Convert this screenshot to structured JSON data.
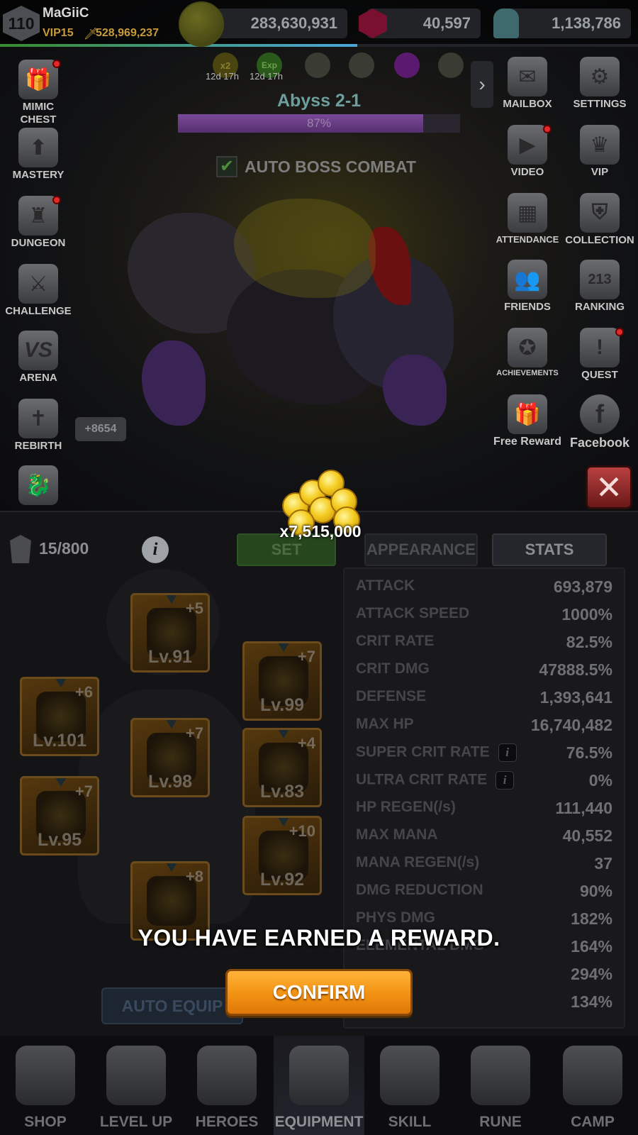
{
  "player": {
    "level": "110",
    "name": "MaGiiC",
    "vip": "VIP15",
    "power": "528,969,237"
  },
  "currencies": {
    "gold": "283,630,931",
    "ruby": "40,597",
    "stone": "1,138,786"
  },
  "buffs": [
    {
      "icon": "x2-gold-buff-icon",
      "label": "x2",
      "timer": "12d 17h"
    },
    {
      "icon": "exp-buff-icon",
      "label": "Exp",
      "timer": "12d 17h"
    }
  ],
  "stage": {
    "title": "Abyss 2-1",
    "progress_text": "87%",
    "progress": 0.87,
    "auto_boss_label": "AUTO BOSS COMBAT",
    "auto_boss_checked": true
  },
  "left_menu": {
    "mimic_chest": "MIMIC CHEST",
    "mastery": "MASTERY",
    "dungeon": "DUNGEON",
    "challenge": "CHALLENGE",
    "arena": "ARENA",
    "arena_icon_text": "VS",
    "rebirth": "REBIRTH",
    "rebirth_count": "+8654"
  },
  "right_menu": {
    "mailbox": "MAILBOX",
    "settings": "SETTINGS",
    "video": "VIDEO",
    "vip": "VIP",
    "attendance": "ATTENDANCE",
    "collection": "COLLECTION",
    "friends": "FRIENDS",
    "ranking": "RANKING",
    "achievements": "ACHIEVEMENTS",
    "quest": "QUEST",
    "free_reward": "Free Reward",
    "facebook": "Facebook"
  },
  "equipment": {
    "bag_count": "15/800",
    "tabs": {
      "set": "SET",
      "appearance": "APPEARANCE",
      "stats": "STATS"
    },
    "slots": [
      {
        "plus": "+5",
        "level": "Lv.91"
      },
      {
        "plus": "+7",
        "level": "Lv.99"
      },
      {
        "plus": "+6",
        "level": "Lv.101"
      },
      {
        "plus": "+7",
        "level": "Lv.98"
      },
      {
        "plus": "+4",
        "level": "Lv.83"
      },
      {
        "plus": "+7",
        "level": "Lv.95"
      },
      {
        "plus": "+10",
        "level": "Lv.92"
      },
      {
        "plus": "+8",
        "level": ""
      }
    ],
    "auto_equip": "AUTO EQUIP"
  },
  "stats": [
    {
      "name": "ATTACK",
      "value": "693,879"
    },
    {
      "name": "ATTACK SPEED",
      "value": "1000%"
    },
    {
      "name": "CRIT RATE",
      "value": "82.5%"
    },
    {
      "name": "CRIT DMG",
      "value": "47888.5%"
    },
    {
      "name": "DEFENSE",
      "value": "1,393,641"
    },
    {
      "name": "MAX HP",
      "value": "16,740,482"
    },
    {
      "name": "SUPER CRIT RATE",
      "value": "76.5%"
    },
    {
      "name": "ULTRA CRIT RATE",
      "value": "0%"
    },
    {
      "name": "HP REGEN(/s)",
      "value": "111,440"
    },
    {
      "name": "MAX MANA",
      "value": "40,552"
    },
    {
      "name": "MANA REGEN(/s)",
      "value": "37"
    },
    {
      "name": "DMG REDUCTION",
      "value": "90%"
    },
    {
      "name": "PHYS DMG",
      "value": "182%"
    },
    {
      "name": "ELEMENTAL DMG",
      "value": "164%"
    },
    {
      "name": "",
      "value": "294%"
    },
    {
      "name": "",
      "value": "134%"
    }
  ],
  "bottom_nav": [
    {
      "label": "SHOP",
      "icon": "treasure-chest-icon"
    },
    {
      "label": "LEVEL UP",
      "icon": "winged-sword-icon"
    },
    {
      "label": "HEROES",
      "icon": "hero-helmet-icon"
    },
    {
      "label": "EQUIPMENT",
      "icon": "knight-helmet-icon",
      "active": true
    },
    {
      "label": "SKILL",
      "icon": "spellbook-icon"
    },
    {
      "label": "RUNE",
      "icon": "rune-stone-icon"
    },
    {
      "label": "CAMP",
      "icon": "tent-icon"
    }
  ],
  "reward": {
    "amount": "x7,515,000",
    "message": "YOU HAVE EARNED A REWARD.",
    "confirm": "CONFIRM",
    "icon": "gold-coins-icon"
  },
  "colors": {
    "confirm_orange": "#f39414",
    "stage_purple": "#7a4a9a",
    "stage_title": "#6d9d9c",
    "gold_text": "#c89a3a"
  }
}
